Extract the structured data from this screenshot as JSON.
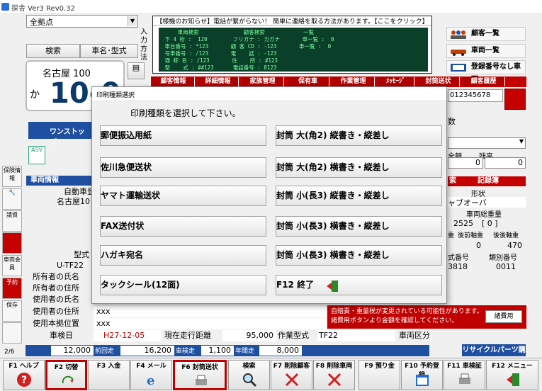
{
  "window": {
    "title": "探舎 Ver3 Rev0.32"
  },
  "top": {
    "branch_select": "全拠点",
    "search_button": "検索",
    "carname_button": "車名･型式",
    "input_method_label": "入力方法"
  },
  "plate": {
    "region": "名古屋 100",
    "hira": "か",
    "number": "10-0"
  },
  "notice": {
    "header": "【様機のお知らせ】電話が繋がらない！ 簡単に連絡を取る方法があります。【ここをクリック】",
    "terminal_text": "     車両検索              顧客検索            一覧\n 下 4 桁 :  120        フリガナ : カガナ       車一覧 :  0\n 車台番号 : *123       顧 客 CD : -123       車一覧 :  0\n 号車番号 : /123       電    話 : -123\n 通 称 名 : /123       住    所 : #123\n 型    式 : ##123      電話番号 : 8123\n                       車両番号 : 8123"
  },
  "right_buttons": {
    "customer_list": "顧客一覧",
    "vehicle_list": "車両一覧",
    "unregistered": "登録番号なし車両"
  },
  "tabs": [
    "顧客情報",
    "詳細情報",
    "家族管理",
    "保有車",
    "作業管理",
    "ﾒｯｾｰｼﾞ",
    "封筒送状",
    "顧客履歴"
  ],
  "left": {
    "one_stop": "ワンストップ",
    "asv": "ASV",
    "vehicle_info": "車両情報",
    "icons": [
      "保険情報",
      "",
      "請資",
      "",
      "車両会員",
      "予約",
      "保存",
      ""
    ]
  },
  "rows": {
    "auto_reg_label": "自動車登",
    "auto_reg_value": "名古屋10",
    "model_label": "型式",
    "model_value": "U-TF22",
    "owner_name": "所有者の氏名",
    "owner_address": "所有者の住所",
    "user_name": "使用者の氏名",
    "user_address": "使用者の住所",
    "user_address_value": "xxx",
    "base_location": "使用本拠位置",
    "base_location_value": "xxx",
    "inspection_label": "車検日",
    "inspection_value": "H27-12-05",
    "mileage_label": "現在走行距離",
    "mileage_value": "95,000",
    "work_type_label": "作業型式",
    "work_type_value": "TF22",
    "vehicle_class_label": "車両区分"
  },
  "right_info": {
    "phone": "012345678",
    "count_label": "数",
    "total_label": "全額",
    "balance_label": "残高",
    "total_value": "0",
    "balance_value": "0",
    "search_tab": "索",
    "record_tab": "記録簿",
    "shape_label": "形状",
    "shape_value": "ャブオーバ",
    "gross_weight_label": "車両総重量",
    "gross_weight_value": "2525",
    "bracket_value": "[  0  ]",
    "rear_axle_label": "後前軸重",
    "rear_axle2_label": "後後軸重",
    "axle_value": "0",
    "axle_value2": "470",
    "engine_label": "式番号",
    "category_label": "類別番号",
    "engine_value": "3818",
    "category_value": "0011",
    "weight_label": "重"
  },
  "status": {
    "page": "2/6",
    "v1": "12,000",
    "label2": "前回走",
    "v2": "16,200",
    "label3": "車検走",
    "v3": "1,100",
    "label4": "年間走",
    "v4": "8,000",
    "recycle": "リサイクルパーツ購入"
  },
  "warning": {
    "text": "自賠責・重量税が変更されている可能性があります。\n諸費用ボタンより金額を確認してください。",
    "button": "諸費用"
  },
  "dialog": {
    "title": "印刷種類選択",
    "prompt": "印刷種類を選択して下さい。",
    "left_buttons": [
      "郵便振込用紙",
      "佐川急便送状",
      "ヤマト運輸送状",
      "FAX送付状",
      "ハガキ宛名",
      "タックシール(12面)"
    ],
    "right_buttons": [
      "封筒 大(角2) 縦書き・縦差し",
      "封筒 大(角2) 横書き・縦差し",
      "封筒 小(長3) 縦書き・縦差し",
      "封筒 小(長3) 横書き・縦差し",
      "封筒 小(長3) 横書き・縦差し"
    ],
    "exit_button": "F12 終了"
  },
  "fkeys": [
    "F1 ヘルプ",
    "F2 切替",
    "F3 入金",
    "F4 メール",
    "F6 封筒送状",
    "検索",
    "F7 削除顧客",
    "F8 削除車両",
    "F9 預り金",
    "F10 予約登録",
    "F11 車検証",
    "F12 メニュー"
  ],
  "colors": {
    "accent_red": "#c00000",
    "accent_blue": "#1f4fa0"
  }
}
